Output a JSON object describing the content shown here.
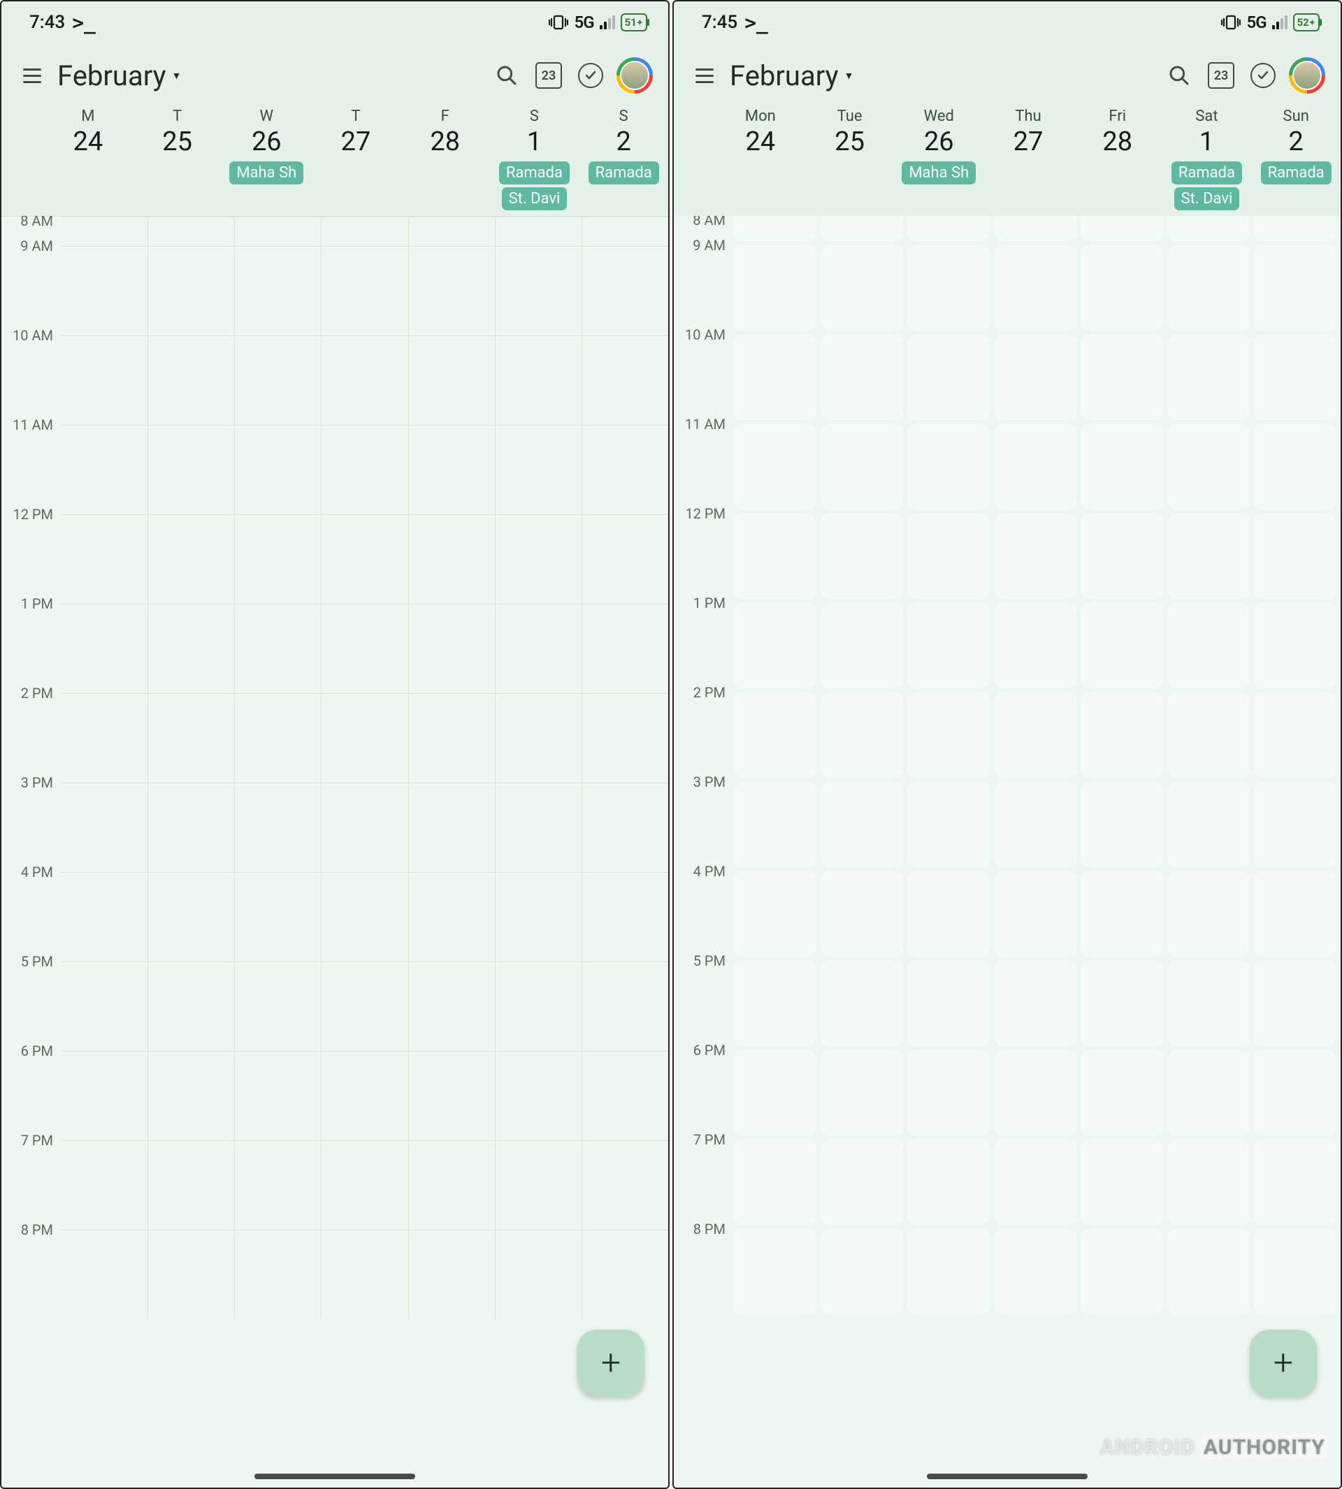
{
  "screens": [
    {
      "status": {
        "time": "7:43",
        "network": "5G",
        "battery": "51"
      },
      "appbar": {
        "month": "February",
        "today_num": "23"
      },
      "dow_labels": [
        "M",
        "T",
        "W",
        "T",
        "F",
        "S",
        "S"
      ],
      "dates": [
        "24",
        "25",
        "26",
        "27",
        "28",
        "1",
        "2"
      ],
      "chips": [
        [],
        [],
        [
          "Maha Sh"
        ],
        [],
        [],
        [
          "Ramada",
          "St. Davi"
        ],
        [
          "Ramada"
        ]
      ],
      "hours": [
        "8 AM",
        "9 AM",
        "10 AM",
        "11 AM",
        "12 PM",
        "1 PM",
        "2 PM",
        "3 PM",
        "4 PM",
        "5 PM",
        "6 PM",
        "7 PM",
        "8 PM"
      ]
    },
    {
      "status": {
        "time": "7:45",
        "network": "5G",
        "battery": "52"
      },
      "appbar": {
        "month": "February",
        "today_num": "23"
      },
      "dow_labels": [
        "Mon",
        "Tue",
        "Wed",
        "Thu",
        "Fri",
        "Sat",
        "Sun"
      ],
      "dates": [
        "24",
        "25",
        "26",
        "27",
        "28",
        "1",
        "2"
      ],
      "chips": [
        [],
        [],
        [
          "Maha Sh"
        ],
        [],
        [],
        [
          "Ramada",
          "St. Davi"
        ],
        [
          "Ramada"
        ]
      ],
      "hours": [
        "8 AM",
        "9 AM",
        "10 AM",
        "11 AM",
        "12 PM",
        "1 PM",
        "2 PM",
        "3 PM",
        "4 PM",
        "5 PM",
        "6 PM",
        "7 PM",
        "8 PM"
      ]
    }
  ],
  "watermark": {
    "part1": "ANDROID",
    "part2": "AUTHORITY"
  }
}
